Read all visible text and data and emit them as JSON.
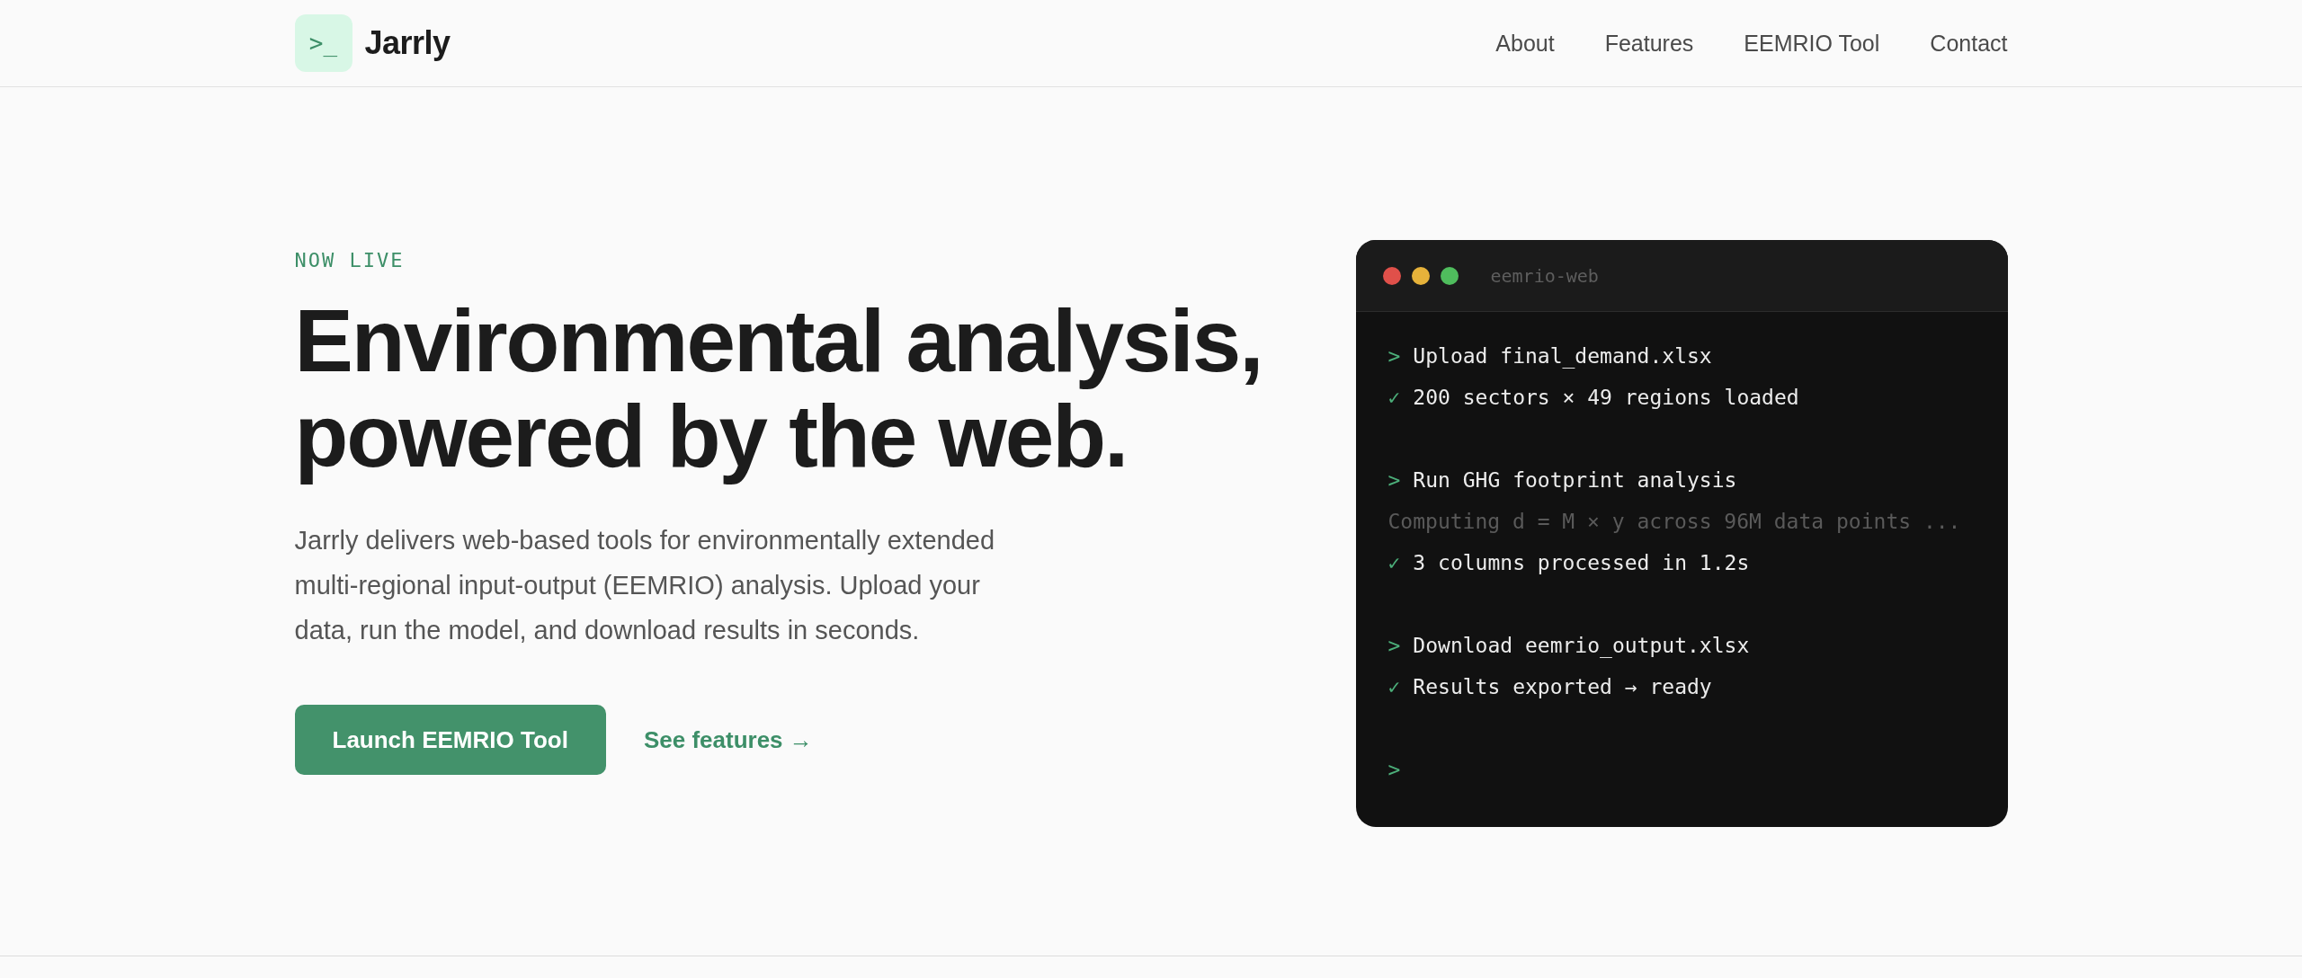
{
  "header": {
    "logo_glyph": ">_",
    "brand": "Jarrly",
    "nav": [
      {
        "label": "About"
      },
      {
        "label": "Features"
      },
      {
        "label": "EEMRIO Tool"
      },
      {
        "label": "Contact"
      }
    ]
  },
  "hero": {
    "eyebrow": "NOW LIVE",
    "headline": [
      "Environmental analysis,",
      "powered by the web."
    ],
    "description": "Jarrly delivers web-based tools for environmentally extended multi-regional input-output (EEMRIO) analysis. Upload your data, run the model, and download results in seconds.",
    "primary_button": "Launch EEMRIO Tool",
    "secondary_link": "See features →"
  },
  "terminal": {
    "title": "eemrio-web",
    "blocks": [
      [
        {
          "kind": "command",
          "prefix": ">",
          "text": "Upload final_demand.xlsx"
        },
        {
          "kind": "success",
          "prefix": "✓",
          "text": "200 sectors × 49 regions loaded"
        }
      ],
      [
        {
          "kind": "command",
          "prefix": ">",
          "text": "Run GHG footprint analysis"
        },
        {
          "kind": "progress",
          "text": "Computing d = M × y across 96M data points ..."
        },
        {
          "kind": "success",
          "prefix": "✓",
          "text": "3 columns processed in 1.2s"
        }
      ],
      [
        {
          "kind": "command",
          "prefix": ">",
          "text": "Download eemrio_output.xlsx"
        },
        {
          "kind": "success",
          "prefix": "✓",
          "text": "Results exported → ready"
        }
      ],
      [
        {
          "kind": "prompt",
          "prefix": ">"
        }
      ]
    ]
  }
}
